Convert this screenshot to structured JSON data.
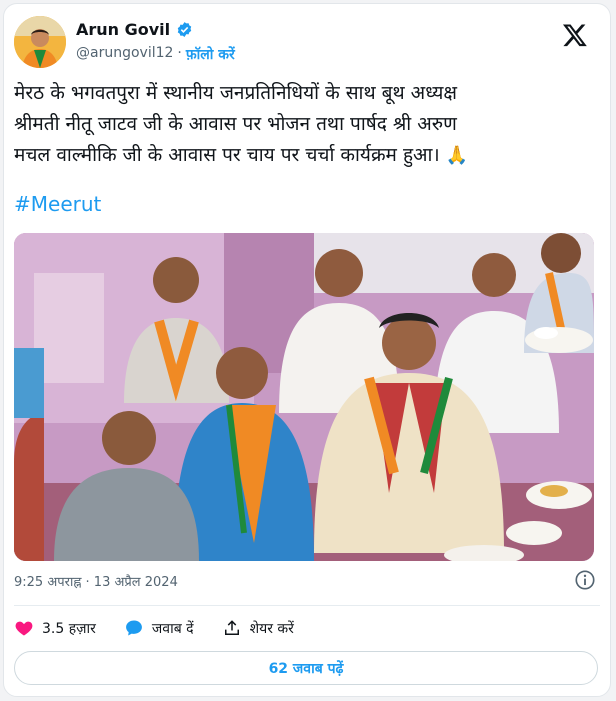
{
  "header": {
    "name": "Arun Govil",
    "handle": "@arungovil12",
    "separator": "·",
    "follow_label": "फ़ॉलो करें"
  },
  "tweet": {
    "text_lines": [
      "मेरठ के भगवतपुरा  में स्थानीय जनप्रतिनिधियों के साथ बूथ अध्यक्ष",
      "श्रीमती नीतू जाटव जी के आवास पर भोजन तथा पार्षद श्री अरुण",
      "मचल वाल्मीकि जी के आवास पर चाय पर चर्चा कार्यक्रम हुआ।"
    ],
    "emoji": "🙏",
    "hashtag": "#Meerut",
    "timestamp": "9:25 अपराह्न · 13 अप्रैल 2024"
  },
  "actions": {
    "likes": "3.5 हज़ार",
    "reply_label": "जवाब दें",
    "share_label": "शेयर करें"
  },
  "replies_button": "62 जवाब पढ़ें",
  "colors": {
    "accent": "#1d9bf0",
    "like": "#f91880",
    "text": "#0f1419",
    "secondary": "#536471"
  },
  "icons": {
    "verified": "verified-badge-icon",
    "x": "x-logo-icon",
    "info": "info-icon",
    "like": "heart-icon",
    "reply": "speech-bubble-icon",
    "share": "upload-share-icon"
  }
}
